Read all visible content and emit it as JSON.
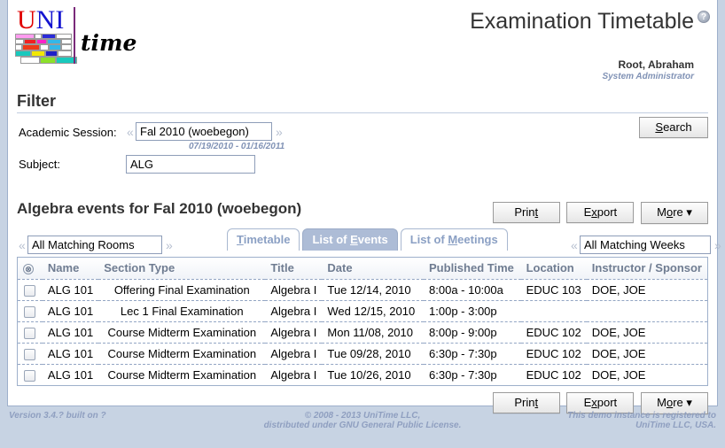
{
  "header": {
    "title": "Examination Timetable",
    "help_icon": "question-mark-icon",
    "logo": {
      "uni_u": "U",
      "uni_n": "NI",
      "time": "time"
    },
    "user_name": "Root, Abraham",
    "user_role": "System Administrator"
  },
  "filter": {
    "section_title": "Filter",
    "search_label_pre": "S",
    "search_label_post": "earch",
    "academic_session_label": "Academic Session:",
    "academic_session_value": "Fal 2010 (woebegon)",
    "academic_session_placeholder": "Academic Session",
    "session_date_range": "07/19/2010 - 01/16/2011",
    "subject_label": "Subject:",
    "subject_value": "ALG",
    "subject_placeholder": "Subject",
    "prev_chevron": "«",
    "next_chevron": "»"
  },
  "results": {
    "title": "Algebra events for Fal 2010 (woebegon)",
    "rooms_filter_value": "All Matching Rooms",
    "rooms_filter_placeholder": "All Matching Rooms",
    "weeks_filter_value": "All Matching Weeks",
    "weeks_filter_placeholder": "All Matching Weeks",
    "tabs": [
      {
        "pre": "",
        "key": "T",
        "post": "imetable",
        "active": false
      },
      {
        "pre": "List of ",
        "key": "E",
        "post": "vents",
        "active": true
      },
      {
        "pre": "List of ",
        "key": "M",
        "post": "eetings",
        "active": false
      }
    ],
    "buttons": [
      {
        "pre": "Prin",
        "key": "t",
        "post": ""
      },
      {
        "pre": "E",
        "key": "x",
        "post": "port"
      },
      {
        "pre": "M",
        "key": "o",
        "post": "re ▾"
      }
    ]
  },
  "table": {
    "select_all_icon": "⊗",
    "columns": [
      "Name",
      "Section Type",
      "Title",
      "Date",
      "Published Time",
      "Location",
      "Instructor / Sponsor"
    ],
    "rows": [
      {
        "name": "ALG 101",
        "section_type": "Offering Final Examination",
        "title": "Algebra I",
        "date": "Tue 12/14, 2010",
        "published_time": "8:00a - 10:00a",
        "location": "EDUC 103",
        "instructor": "DOE, JOE"
      },
      {
        "name": "ALG 101",
        "section_type": "Lec 1 Final Examination",
        "title": "Algebra I",
        "date": "Wed 12/15, 2010",
        "published_time": "1:00p - 3:00p",
        "location": "",
        "instructor": ""
      },
      {
        "name": "ALG 101",
        "section_type": "Course Midterm Examination",
        "title": "Algebra I",
        "date": "Mon 11/08, 2010",
        "published_time": "8:00p - 9:00p",
        "location": "EDUC 102",
        "instructor": "DOE, JOE"
      },
      {
        "name": "ALG 101",
        "section_type": "Course Midterm Examination",
        "title": "Algebra I",
        "date": "Tue 09/28, 2010",
        "published_time": "6:30p - 7:30p",
        "location": "EDUC 102",
        "instructor": "DOE, JOE"
      },
      {
        "name": "ALG 101",
        "section_type": "Course Midterm Examination",
        "title": "Algebra I",
        "date": "Tue 10/26, 2010",
        "published_time": "6:30p - 7:30p",
        "location": "EDUC 102",
        "instructor": "DOE, JOE"
      }
    ]
  },
  "footer": {
    "version": "Version 3.4.? built on ?",
    "copyright_line1": "© 2008 - 2013 UniTime LLC,",
    "copyright_line2": "distributed under GNU General Public License.",
    "registered_line1": "This demo instance is registered to",
    "registered_line2": "UniTime LLC, USA."
  },
  "colors": {
    "page_background": "#c7d3e3",
    "accent_blue": "#8092b5",
    "tab_active": "#adbcd6",
    "border": "#9eb0cb",
    "logo_red": "#e00000",
    "logo_blue": "#1414d0",
    "logo_green": "#008000",
    "logo_purple": "#7a2a7a"
  }
}
